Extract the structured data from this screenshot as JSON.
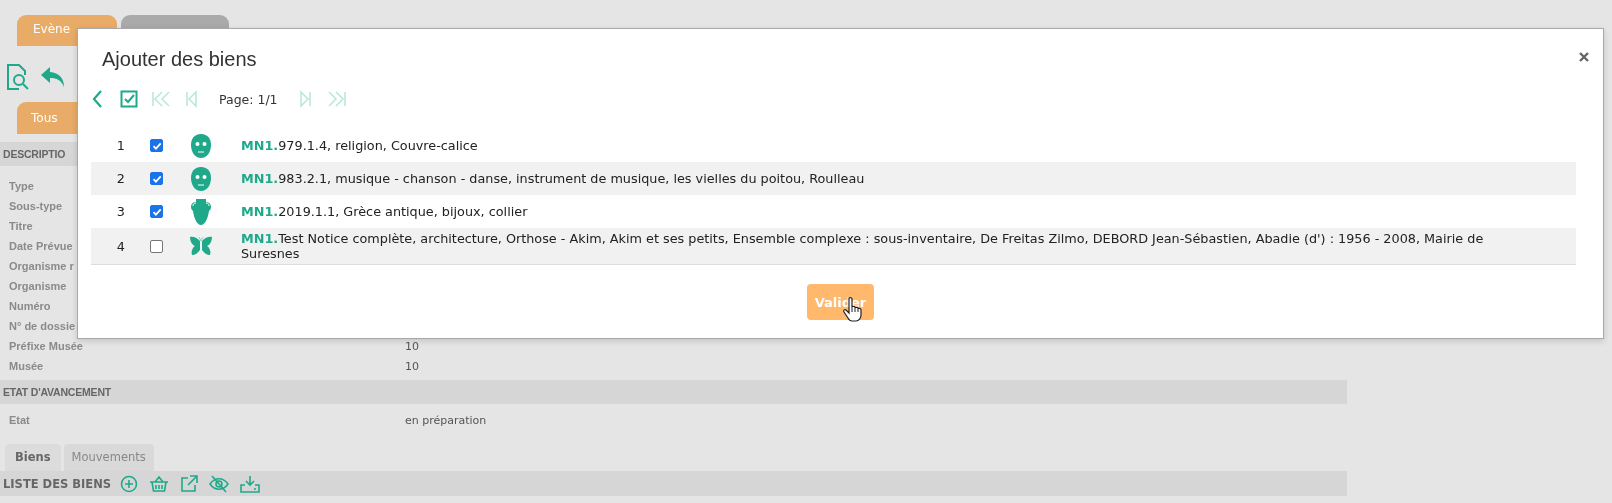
{
  "page": {
    "top_tabs": [
      {
        "label": "Evène",
        "selected": true
      },
      {
        "selected": false
      }
    ],
    "filter_tab": {
      "label": "Tous",
      "selected": true
    },
    "sections": [
      {
        "title": "DESCRIPTIO",
        "fields": [
          {
            "label": "Type"
          },
          {
            "label": "Sous-type"
          },
          {
            "label": "Titre"
          },
          {
            "label": "Date Prévue"
          },
          {
            "label": "Organisme r"
          },
          {
            "label": "Organisme"
          },
          {
            "label": "Numéro"
          },
          {
            "label": "N° de dossie"
          },
          {
            "label": "Préfixe Musée",
            "value": "10"
          },
          {
            "label": "Musée",
            "value": "10"
          }
        ]
      },
      {
        "title": "ETAT D'AVANCEMENT",
        "fields": [
          {
            "label": "Etat",
            "value": "en préparation"
          }
        ]
      }
    ],
    "bottom_tabs": [
      {
        "label": "Biens",
        "selected": true
      },
      {
        "label": "Mouvements",
        "selected": false
      }
    ],
    "list_header": {
      "title": "LISTE DES BIENS"
    }
  },
  "dialog": {
    "title": "Ajouter des biens",
    "nav_left": [
      {
        "kind": "back",
        "disabled": false
      },
      {
        "kind": "select_all",
        "disabled": false
      },
      {
        "kind": "first",
        "disabled": true
      },
      {
        "kind": "prev",
        "disabled": true
      }
    ],
    "page_label": "Page: 1/1",
    "nav_right": [
      {
        "kind": "next",
        "disabled": true
      },
      {
        "kind": "last",
        "disabled": true
      }
    ],
    "rows": [
      {
        "number": "1",
        "checked": true,
        "kind": "mask",
        "text": "**MN1.**979.1.4, religion, Couvre-calice"
      },
      {
        "number": "2",
        "checked": true,
        "kind": "mask",
        "text": "**MN1.**983.2.1, musique - chanson - danse, instrument de musique, les vielles du poitou, Roulleau"
      },
      {
        "number": "3",
        "checked": true,
        "kind": "vase",
        "text": "**MN1.**2019.1.1, Grèce antique, bijoux, collier"
      },
      {
        "number": "4",
        "checked": false,
        "kind": "butterfly",
        "text": "**MN1.**Test Notice complète, architecture, Orthose - Akim, Akim et ses petits, Ensemble complexe : sous-inventaire, De Freitas Zilmo, DEBORD Jean-Sébastien, Abadie (d') : 1956 - 2008, Mairie de Suresnes"
      }
    ],
    "button": "Valider"
  }
}
